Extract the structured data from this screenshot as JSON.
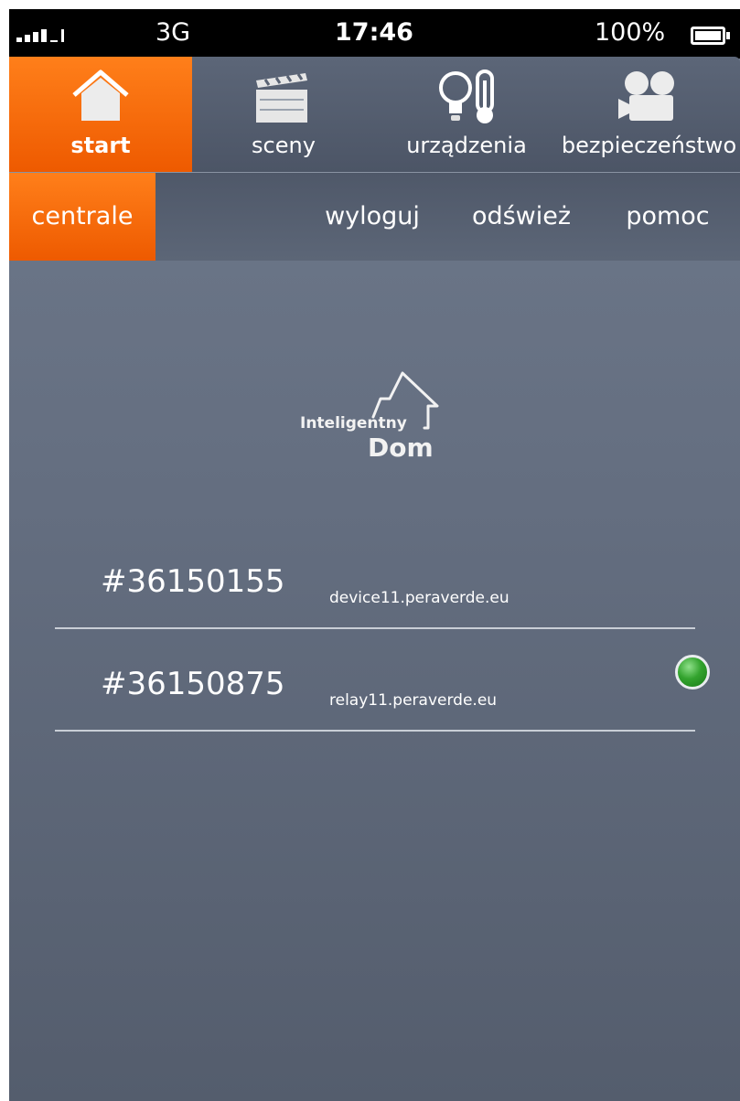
{
  "status_bar": {
    "carrier": "3G",
    "time": "17:46",
    "battery": "100%",
    "signal_icon": "signal-bars-icon",
    "battery_icon": "battery-full-icon"
  },
  "tabs": [
    {
      "label": "start",
      "icon": "home-icon",
      "active": true
    },
    {
      "label": "sceny",
      "icon": "clapperboard-icon",
      "active": false
    },
    {
      "label": "urządzenia",
      "icon": "bulb-thermometer-icon",
      "active": false
    },
    {
      "label": "bezpieczeństwo",
      "icon": "video-camera-icon",
      "active": false
    }
  ],
  "subnav": [
    {
      "label": "centrale",
      "active": true
    },
    {
      "label": "wyloguj",
      "active": false
    },
    {
      "label": "odśwież",
      "active": false
    },
    {
      "label": "pomoc",
      "active": false
    }
  ],
  "logo": {
    "line1": "Inteligentny",
    "line2": "Dom"
  },
  "centrals": [
    {
      "id": "#36150155",
      "host": "device11.peraverde.eu",
      "online": false
    },
    {
      "id": "#36150875",
      "host": "relay11.peraverde.eu",
      "online": true
    }
  ],
  "colors": {
    "accent": "#f26a0a",
    "background": "#656f81",
    "online": "#2f9f2b"
  }
}
